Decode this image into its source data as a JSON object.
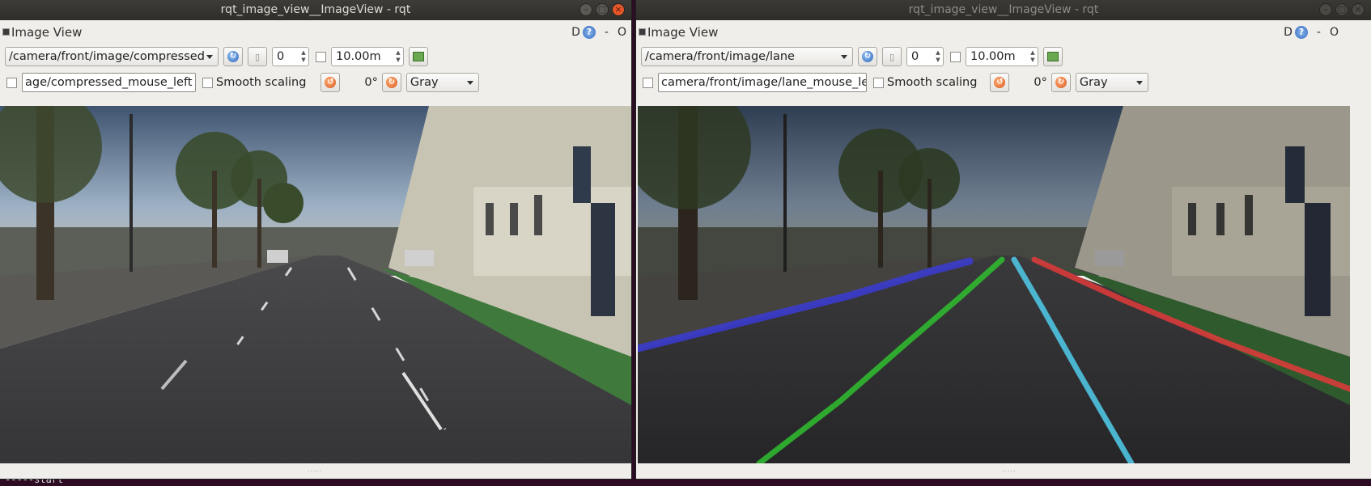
{
  "terminal": {
    "text": "-----start"
  },
  "windows": [
    {
      "title": "rqt_image_view__ImageView - rqt",
      "dock_title": "Image View",
      "dock_buttons": {
        "d": "D",
        "help": "?",
        "dash": "-",
        "o": "O"
      },
      "topic": "/camera/front/image/compressed",
      "spin_value": "0",
      "duration": "10.00m",
      "mouse_topic": "age/compressed_mouse_left",
      "smooth_label": "Smooth scaling",
      "rotation": "0°",
      "color_mode": "Gray",
      "lane_overlay": false
    },
    {
      "title": "rqt_image_view__ImageView - rqt",
      "dock_title": "Image View",
      "dock_buttons": {
        "d": "D",
        "help": "?",
        "dash": "-",
        "o": "O"
      },
      "topic": "/camera/front/image/lane",
      "spin_value": "0",
      "duration": "10.00m",
      "mouse_topic": "camera/front/image/lane_mouse_left",
      "smooth_label": "Smooth scaling",
      "rotation": "0°",
      "color_mode": "Gray",
      "lane_overlay": true
    }
  ],
  "icons": {
    "refresh": "refresh-icon",
    "pause": "pause-icon",
    "save": "save-image-icon",
    "rotate_left": "rotate-left-icon",
    "rotate_right": "rotate-right-icon"
  },
  "colors": {
    "lane_left": "#3b3bd6",
    "lane_center_left": "#2fbf2f",
    "lane_center_right": "#4fc3e0",
    "lane_right": "#e23b3b",
    "bike_lane": "#3f7a3c"
  }
}
